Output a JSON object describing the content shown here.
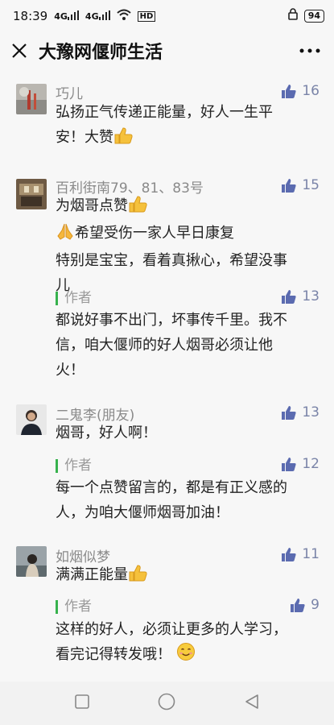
{
  "status": {
    "time": "18:39",
    "signal": "4G",
    "network_type": "HD",
    "battery": "94"
  },
  "header": {
    "title": "大豫网偃师生活",
    "more": "···"
  },
  "comments": [
    {
      "name": "巧儿",
      "likes": "16",
      "text": [
        "弘扬正气传递正能量，好人一生平",
        "安！大赞"
      ]
    },
    {
      "name": "百利街南79、81、83号",
      "likes": "15",
      "text": [
        "为烟哥点赞",
        "希望受伤一家人早日康复",
        "特别是宝宝，看着真揪心，希望没事",
        "儿"
      ],
      "reply": {
        "label": "作者",
        "likes": "13",
        "text": [
          "都说好事不出门，坏事传千里。我不",
          "信，咱大偃师的好人烟哥必须让他",
          "火！"
        ]
      }
    },
    {
      "name": "二鬼李(朋友)",
      "likes": "13",
      "text": [
        "烟哥，好人啊！"
      ],
      "reply": {
        "label": "作者",
        "likes": "12",
        "text": [
          "每一个点赞留言的，都是有正义感的",
          "人，为咱大偃师烟哥加油！"
        ]
      }
    },
    {
      "name": "如烟似梦",
      "likes": "11",
      "text": [
        "满满正能量"
      ],
      "reply": {
        "label": "作者",
        "likes": "9",
        "text": [
          "这样的好人，必须让更多的人学习，",
          "看完记得转发哦！"
        ]
      }
    }
  ]
}
